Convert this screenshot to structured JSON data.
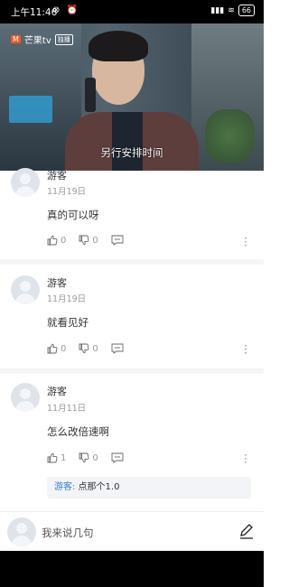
{
  "status_bar": {
    "time": "上午11:46",
    "battery": "66"
  },
  "video": {
    "brand": "芒果tv",
    "badge": "独播",
    "subtitle": "另行安排时间"
  },
  "comments": [
    {
      "user": "游客",
      "date": "11月19日",
      "text": "真的可以呀",
      "likes": "0",
      "dislikes": "0"
    },
    {
      "user": "游客",
      "date": "11月19日",
      "text": "就看见好",
      "likes": "0",
      "dislikes": "0"
    },
    {
      "user": "游客",
      "date": "11月11日",
      "text": "怎么改倍速啊",
      "likes": "1",
      "dislikes": "0",
      "reply": {
        "user": "游客:",
        "text": " 点那个1.0"
      }
    }
  ],
  "input": {
    "placeholder": "我来说几句"
  },
  "icons": {
    "like": "thumb-up-icon",
    "dislike": "thumb-down-icon",
    "comment": "comment-icon",
    "more": "more-vert-icon",
    "write": "pen-icon"
  }
}
